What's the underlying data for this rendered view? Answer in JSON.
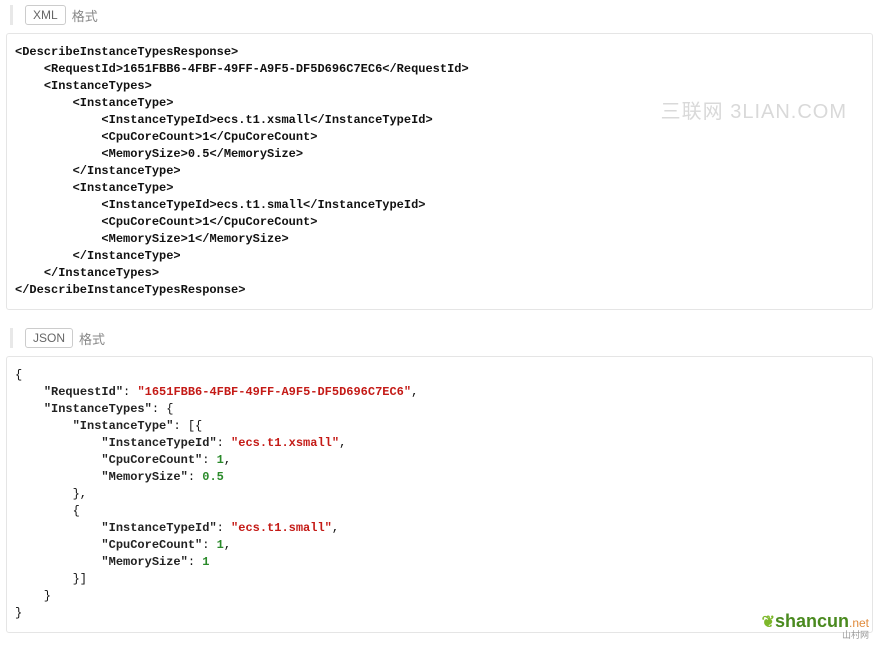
{
  "sections": {
    "xml": {
      "badge": "XML",
      "label": "格式"
    },
    "json": {
      "badge": "JSON",
      "label": "格式"
    }
  },
  "xml_code": "<DescribeInstanceTypesResponse>\n    <RequestId>1651FBB6-4FBF-49FF-A9F5-DF5D696C7EC6</RequestId>\n    <InstanceTypes>\n        <InstanceType>\n            <InstanceTypeId>ecs.t1.xsmall</InstanceTypeId>\n            <CpuCoreCount>1</CpuCoreCount>\n            <MemorySize>0.5</MemorySize>\n        </InstanceType>\n        <InstanceType>\n            <InstanceTypeId>ecs.t1.small</InstanceTypeId>\n            <CpuCoreCount>1</CpuCoreCount>\n            <MemorySize>1</MemorySize>\n        </InstanceType>\n    </InstanceTypes>\n</DescribeInstanceTypesResponse>",
  "json_code": {
    "RequestId": "1651FBB6-4FBF-49FF-A9F5-DF5D696C7EC6",
    "InstanceTypes": {
      "InstanceType": [
        {
          "InstanceTypeId": "ecs.t1.xsmall",
          "CpuCoreCount": 1,
          "MemorySize": 0.5
        },
        {
          "InstanceTypeId": "ecs.t1.small",
          "CpuCoreCount": 1,
          "MemorySize": 1
        }
      ]
    }
  },
  "watermark1": "三联网 3LIAN.COM",
  "watermark2": {
    "main": "shancun",
    "suffix": ".net",
    "cn": "山村网"
  }
}
